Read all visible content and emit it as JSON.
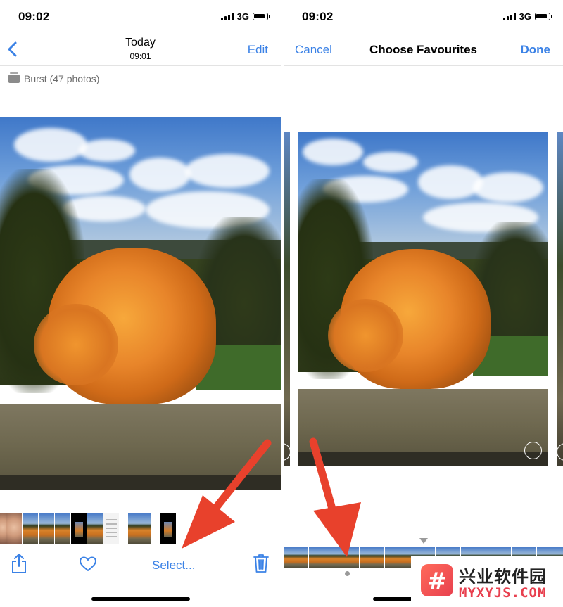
{
  "left_screen": {
    "status_bar": {
      "time": "09:02",
      "network": "3G"
    },
    "nav": {
      "title": "Today",
      "subtitle": "09:01",
      "edit_label": "Edit"
    },
    "burst_label": "Burst (47 photos)",
    "toolbar": {
      "select_label": "Select..."
    }
  },
  "right_screen": {
    "status_bar": {
      "time": "09:02",
      "network": "3G"
    },
    "nav": {
      "cancel_label": "Cancel",
      "title": "Choose Favourites",
      "done_label": "Done"
    }
  },
  "watermark": {
    "chinese": "兴业软件园",
    "url": "MYXYJS.COM"
  },
  "colors": {
    "ios_blue": "#3b82e6",
    "arrow_red": "#e8412c",
    "watermark_red": "#e8404f"
  },
  "icons": [
    "back-chevron-icon",
    "share-icon",
    "heart-icon",
    "trash-icon",
    "burst-icon",
    "signal-icon",
    "battery-icon"
  ]
}
